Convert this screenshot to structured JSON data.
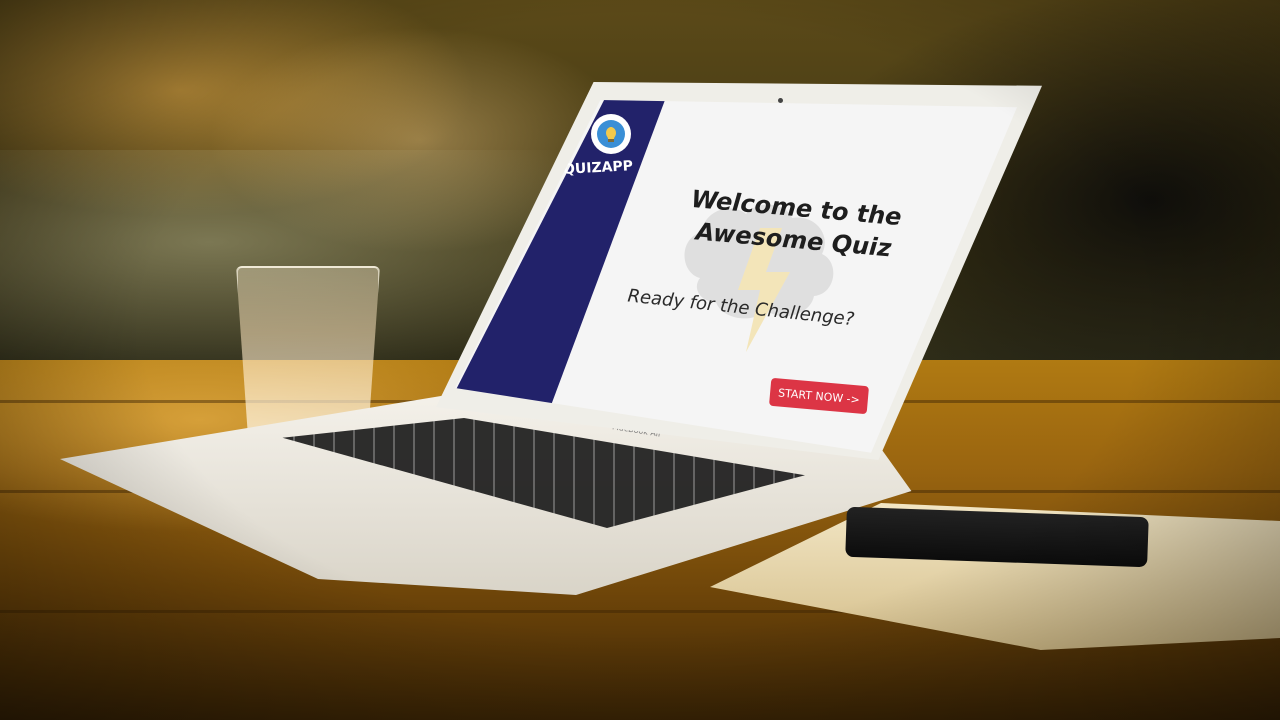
{
  "quiz_app": {
    "brand": "QUIZAPP",
    "logo_icon": "brain-lightbulb-icon",
    "title": "Welcome to the Awesome Quiz",
    "subtitle": "Ready for the Challenge?",
    "start_button_label": "START NOW ->",
    "watermark_icon": "brain-lightning-icon"
  },
  "device": {
    "model_label": "MacBook Air"
  },
  "colors": {
    "sidebar": "#22226a",
    "accent_button": "#dc3545",
    "screen_background": "#f5f5f5",
    "title_text": "#1e1e1e"
  }
}
